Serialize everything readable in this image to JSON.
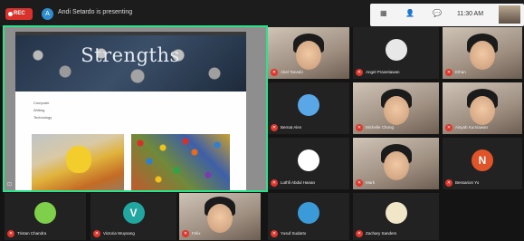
{
  "topbar": {
    "rec_label": "REC",
    "presenter_initial": "A",
    "presenter_text": "Andi Setardo is presenting",
    "clock": "11:30 AM"
  },
  "shared_screen": {
    "slide_title": "Strengths",
    "slide_lines": [
      "Computer",
      "Writing",
      "Technology"
    ],
    "zoom": "100"
  },
  "participants": [
    {
      "name": "Abel Tanado",
      "muted": true,
      "type": "camera"
    },
    {
      "name": "Angel Prasetiawan",
      "muted": true,
      "type": "avatar",
      "initial": "",
      "color": "#e8e8e8"
    },
    {
      "name": "Ethan",
      "muted": true,
      "type": "camera"
    },
    {
      "name": "Bernat Alen",
      "muted": true,
      "type": "avatar",
      "initial": "",
      "color": "#5aa7e8"
    },
    {
      "name": "Michelle Chong",
      "muted": true,
      "type": "camera"
    },
    {
      "name": "Aisyah Kurniawan",
      "muted": true,
      "type": "camera"
    },
    {
      "name": "Luthfi Abdul Hanan",
      "muted": true,
      "type": "avatar",
      "initial": "",
      "color": "#ffffff"
    },
    {
      "name": "Mark",
      "muted": true,
      "type": "camera"
    },
    {
      "name": "Bessarion Yo",
      "muted": true,
      "type": "avatar",
      "initial": "N",
      "color": "#e0542a"
    },
    {
      "name": "Tristan Chandra",
      "muted": true,
      "type": "avatar",
      "initial": "",
      "color": "#7ecf4a"
    },
    {
      "name": "Victoria Wuysang",
      "muted": true,
      "type": "avatar",
      "initial": "V",
      "color": "#21a6a0"
    },
    {
      "name": "Felix",
      "muted": true,
      "type": "camera"
    },
    {
      "name": "Yusuf Sudarto",
      "muted": true,
      "type": "avatar",
      "initial": "",
      "color": "#3a9bd8"
    },
    {
      "name": "Zachary Sanders",
      "muted": true,
      "type": "avatar",
      "initial": "",
      "color": "#f2e6c8"
    }
  ]
}
